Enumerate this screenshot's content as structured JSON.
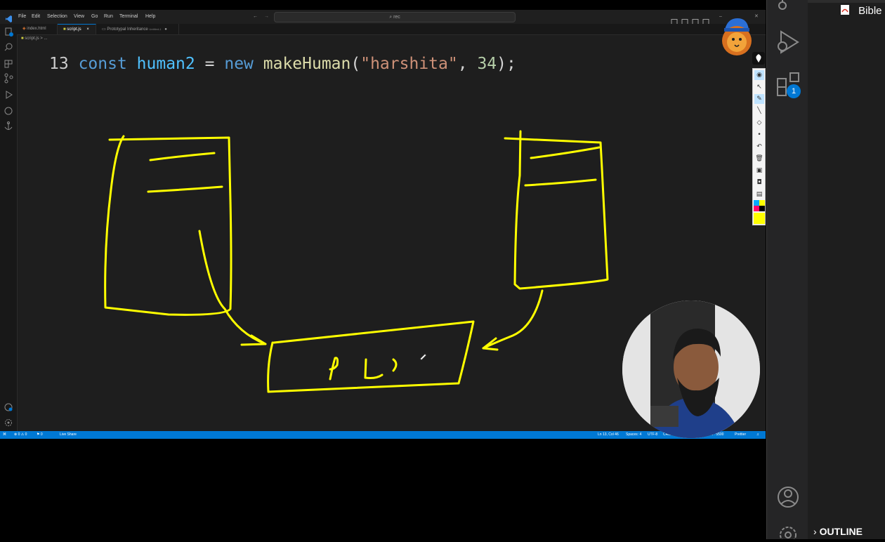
{
  "titlebar": {
    "menu": [
      "File",
      "Edit",
      "Selection",
      "View",
      "Go",
      "Run",
      "Terminal",
      "Help"
    ],
    "search_text": "rec"
  },
  "tabs": [
    {
      "label": "index.html",
      "active": false
    },
    {
      "label": "script.js",
      "active": true,
      "close": "×"
    },
    {
      "label": "Prototypal Inheritance",
      "detail": "Untitled-1",
      "active": false
    }
  ],
  "breadcrumb": "script.js > ...",
  "editor": {
    "line_number": "13",
    "tokens": [
      "const",
      "human2",
      "=",
      "new",
      "makeHuman",
      "(",
      "\"harshita\"",
      ",",
      "34",
      ");"
    ]
  },
  "statusbar": {
    "left": [
      "⊗ 0 ⚠ 0",
      "⚑ 0",
      "Live Share"
    ],
    "right": [
      "Ln 13, Col 46",
      "Spaces: 4",
      "UTF-8",
      "CRLF",
      "Port : 5500",
      "Prettier"
    ]
  },
  "right_panel": {
    "bible_label": "Bible",
    "outline_label": "OUTLINE",
    "extensions_badge": "1"
  },
  "colors": {
    "ink": "#ffff00",
    "accent": "#0078d4",
    "editor_bg": "#1e1e1e"
  },
  "icons": [
    "vscode-logo-icon",
    "explorer-icon",
    "search-icon",
    "source-control-icon",
    "run-debug-icon",
    "remote-icon",
    "anchor-icon",
    "account-icon",
    "settings-icon",
    "extensions-icon",
    "pdf-icon",
    "chevron-right-icon",
    "lion-mascot-icon"
  ]
}
